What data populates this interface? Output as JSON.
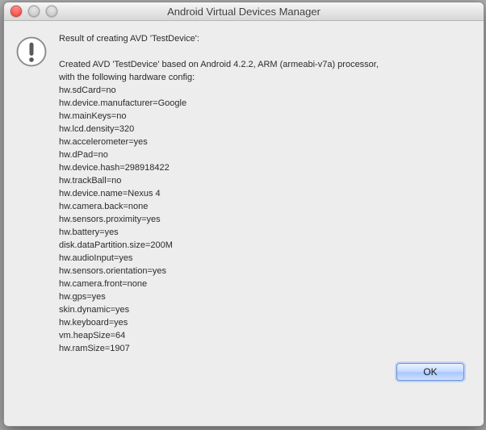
{
  "window": {
    "title": "Android Virtual Devices Manager"
  },
  "dialog": {
    "heading": "Result of creating AVD 'TestDevice':",
    "intro": "Created AVD 'TestDevice' based on Android 4.2.2, ARM (armeabi-v7a) processor,\nwith the following hardware config:",
    "config_lines": [
      "hw.sdCard=no",
      "hw.device.manufacturer=Google",
      "hw.mainKeys=no",
      "hw.lcd.density=320",
      "hw.accelerometer=yes",
      "hw.dPad=no",
      "hw.device.hash=298918422",
      "hw.trackBall=no",
      "hw.device.name=Nexus 4",
      "hw.camera.back=none",
      "hw.sensors.proximity=yes",
      "hw.battery=yes",
      "disk.dataPartition.size=200M",
      "hw.audioInput=yes",
      "hw.sensors.orientation=yes",
      "hw.camera.front=none",
      "hw.gps=yes",
      "skin.dynamic=yes",
      "hw.keyboard=yes",
      "vm.heapSize=64",
      "hw.ramSize=1907"
    ],
    "ok_label": "OK"
  }
}
